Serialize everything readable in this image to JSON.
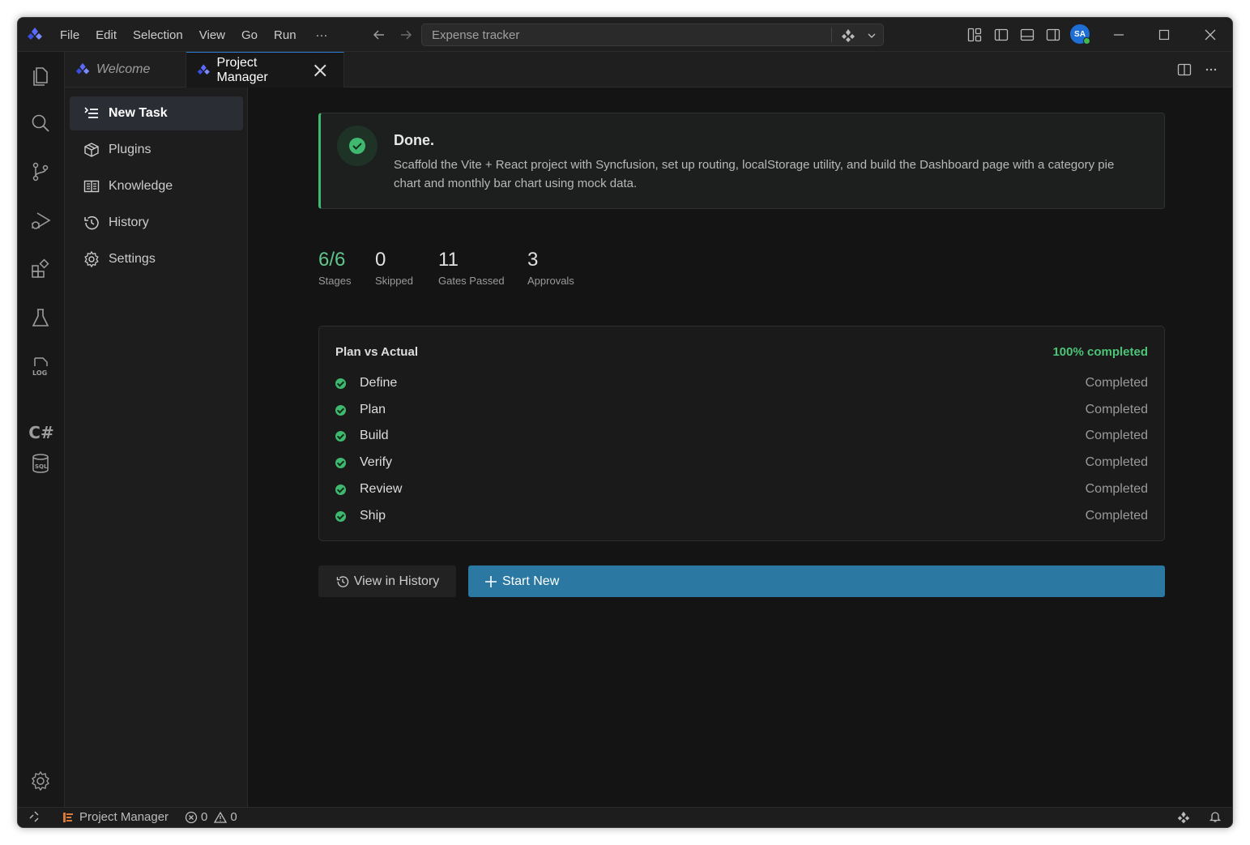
{
  "menu": {
    "items": [
      "File",
      "Edit",
      "Selection",
      "View",
      "Go",
      "Run"
    ],
    "more": "···"
  },
  "command_center": {
    "text": "Expense tracker"
  },
  "account": {
    "initials": "SA"
  },
  "tabs": {
    "welcome": "Welcome",
    "project_manager": "Project Manager"
  },
  "sidebar": {
    "items": [
      {
        "label": "New Task",
        "icon": "new-task-icon"
      },
      {
        "label": "Plugins",
        "icon": "package-icon"
      },
      {
        "label": "Knowledge",
        "icon": "book-icon"
      },
      {
        "label": "History",
        "icon": "history-icon"
      },
      {
        "label": "Settings",
        "icon": "gear-icon"
      }
    ]
  },
  "done": {
    "title": "Done.",
    "description": "Scaffold the Vite + React project with Syncfusion, set up routing, localStorage utility, and build the Dashboard page with a category pie chart and monthly bar chart using mock data."
  },
  "stats": [
    {
      "value": "6/6",
      "label": "Stages"
    },
    {
      "value": "0",
      "label": "Skipped"
    },
    {
      "value": "11",
      "label": "Gates Passed"
    },
    {
      "value": "3",
      "label": "Approvals"
    }
  ],
  "plan": {
    "title": "Plan vs Actual",
    "completion": "100% completed",
    "stages": [
      {
        "name": "Define",
        "status": "Completed"
      },
      {
        "name": "Plan",
        "status": "Completed"
      },
      {
        "name": "Build",
        "status": "Completed"
      },
      {
        "name": "Verify",
        "status": "Completed"
      },
      {
        "name": "Review",
        "status": "Completed"
      },
      {
        "name": "Ship",
        "status": "Completed"
      }
    ]
  },
  "buttons": {
    "view_history": "View in History",
    "start_new": "Start New"
  },
  "statusbar": {
    "project": "Project Manager",
    "errors": "0",
    "warnings": "0"
  },
  "colors": {
    "accent_green": "#3fb970",
    "primary_button": "#2b79a3",
    "tab_active_border": "#2b7cd3"
  }
}
